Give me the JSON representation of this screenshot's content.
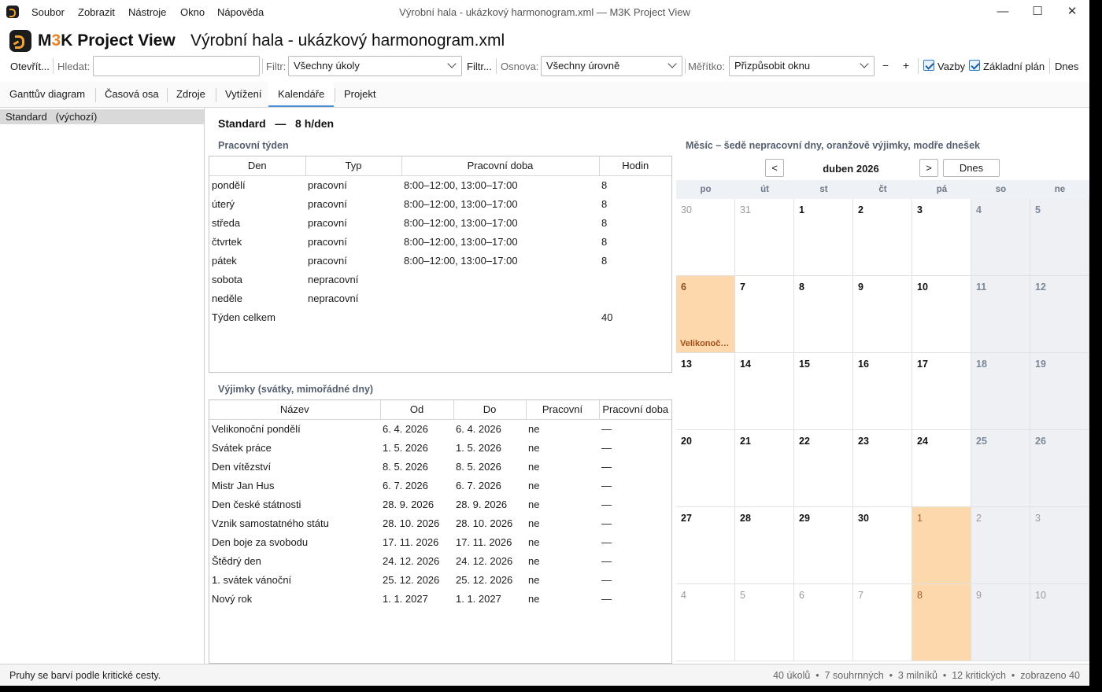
{
  "window": {
    "title": "Výrobní hala - ukázkový harmonogram.xml — M3K Project View",
    "menu": [
      "Soubor",
      "Zobrazit",
      "Nástroje",
      "Okno",
      "Nápověda"
    ]
  },
  "header": {
    "app_name_prefix": "M",
    "app_name_accent": "3",
    "app_name_suffix": "K Project View",
    "file_name": "Výrobní hala - ukázkový harmonogram.xml"
  },
  "toolbar": {
    "open_label": "Otevřít...",
    "search_label": "Hledat:",
    "search_value": "",
    "filter_label": "Filtr:",
    "filter_value": "Všechny úkoly",
    "filter_more_label": "Filtr...",
    "outline_label": "Osnova:",
    "outline_value": "Všechny úrovně",
    "scale_label": "Měřítko:",
    "scale_value": "Přizpůsobit oknu",
    "zoom_out": "−",
    "zoom_in": "+",
    "links_label": "Vazby",
    "baseline_label": "Základní plán",
    "today_label": "Dnes"
  },
  "tabs": [
    "Ganttův diagram",
    "Časová osa",
    "Zdroje",
    "Vytížení",
    "Kalendáře",
    "Projekt"
  ],
  "active_tab": "Kalendáře",
  "calendars": [
    {
      "name": "Standard",
      "note": "(výchozí)"
    }
  ],
  "main": {
    "title": "Standard",
    "title_dash": "—",
    "title_hours": "8 h/den"
  },
  "work_week": {
    "heading": "Pracovní týden",
    "columns": [
      "Den",
      "Typ",
      "Pracovní doba",
      "Hodin"
    ],
    "rows": [
      [
        "pondělí",
        "pracovní",
        "8:00–12:00, 13:00–17:00",
        "8"
      ],
      [
        "úterý",
        "pracovní",
        "8:00–12:00, 13:00–17:00",
        "8"
      ],
      [
        "středa",
        "pracovní",
        "8:00–12:00, 13:00–17:00",
        "8"
      ],
      [
        "čtvrtek",
        "pracovní",
        "8:00–12:00, 13:00–17:00",
        "8"
      ],
      [
        "pátek",
        "pracovní",
        "8:00–12:00, 13:00–17:00",
        "8"
      ],
      [
        "sobota",
        "nepracovní",
        "",
        ""
      ],
      [
        "neděle",
        "nepracovní",
        "",
        ""
      ],
      [
        "Týden celkem",
        "",
        "",
        "40"
      ]
    ]
  },
  "exceptions": {
    "heading": "Výjimky (svátky, mimořádné dny)",
    "columns": [
      "Název",
      "Od",
      "Do",
      "Pracovní",
      "Pracovní doba"
    ],
    "rows": [
      [
        "Velikonoční pondělí",
        "6. 4. 2026",
        "6. 4. 2026",
        "ne",
        "—"
      ],
      [
        "Svátek práce",
        "1. 5. 2026",
        "1. 5. 2026",
        "ne",
        "—"
      ],
      [
        "Den vítězství",
        "8. 5. 2026",
        "8. 5. 2026",
        "ne",
        "—"
      ],
      [
        "Mistr Jan Hus",
        "6. 7. 2026",
        "6. 7. 2026",
        "ne",
        "—"
      ],
      [
        "Den české státnosti",
        "28. 9. 2026",
        "28. 9. 2026",
        "ne",
        "—"
      ],
      [
        "Vznik samostatného státu",
        "28. 10. 2026",
        "28. 10. 2026",
        "ne",
        "—"
      ],
      [
        "Den boje za svobodu",
        "17. 11. 2026",
        "17. 11. 2026",
        "ne",
        "—"
      ],
      [
        "Štědrý den",
        "24. 12. 2026",
        "24. 12. 2026",
        "ne",
        "—"
      ],
      [
        "1. svátek vánoční",
        "25. 12. 2026",
        "25. 12. 2026",
        "ne",
        "—"
      ],
      [
        "Nový rok",
        "1. 1. 2027",
        "1. 1. 2027",
        "ne",
        "—"
      ]
    ]
  },
  "month": {
    "heading": "Měsíc – šedě nepracovní dny, oranžově výjimky, modře dnešek",
    "prev": "<",
    "next": ">",
    "label": "duben 2026",
    "today_button": "Dnes",
    "weekdays": [
      "po",
      "út",
      "st",
      "čt",
      "pá",
      "so",
      "ne"
    ],
    "weeks": [
      [
        {
          "d": "30",
          "other": true
        },
        {
          "d": "31",
          "other": true
        },
        {
          "d": "1"
        },
        {
          "d": "2"
        },
        {
          "d": "3"
        },
        {
          "d": "4",
          "wknd": true
        },
        {
          "d": "5",
          "wknd": true
        }
      ],
      [
        {
          "d": "6",
          "exc": true,
          "cur": true,
          "evt": "Velikonoční pondělí"
        },
        {
          "d": "7"
        },
        {
          "d": "8"
        },
        {
          "d": "9"
        },
        {
          "d": "10"
        },
        {
          "d": "11",
          "wknd": true
        },
        {
          "d": "12",
          "wknd": true
        }
      ],
      [
        {
          "d": "13"
        },
        {
          "d": "14"
        },
        {
          "d": "15"
        },
        {
          "d": "16"
        },
        {
          "d": "17"
        },
        {
          "d": "18",
          "wknd": true
        },
        {
          "d": "19",
          "wknd": true
        }
      ],
      [
        {
          "d": "20"
        },
        {
          "d": "21"
        },
        {
          "d": "22"
        },
        {
          "d": "23"
        },
        {
          "d": "24"
        },
        {
          "d": "25",
          "wknd": true
        },
        {
          "d": "26",
          "wknd": true
        }
      ],
      [
        {
          "d": "27"
        },
        {
          "d": "28"
        },
        {
          "d": "29"
        },
        {
          "d": "30"
        },
        {
          "d": "1",
          "other": true,
          "exc": true
        },
        {
          "d": "2",
          "other": true,
          "wknd": true
        },
        {
          "d": "3",
          "other": true,
          "wknd": true
        }
      ],
      [
        {
          "d": "4",
          "other": true
        },
        {
          "d": "5",
          "other": true
        },
        {
          "d": "6",
          "other": true
        },
        {
          "d": "7",
          "other": true
        },
        {
          "d": "8",
          "other": true,
          "exc": true
        },
        {
          "d": "9",
          "other": true,
          "wknd": true
        },
        {
          "d": "10",
          "other": true,
          "wknd": true
        }
      ]
    ]
  },
  "status": {
    "left": "Pruhy se barví podle kritické cesty.",
    "right": "40 úkolů  •  7 souhrnných  •  3 milníků  •  12 kritických  •  zobrazeno 40"
  },
  "colors": {
    "accent": "#4a90d9",
    "exception": "#fdd8ad",
    "weekend": "#eef0f3",
    "logo_orange": "#f2a33a"
  }
}
